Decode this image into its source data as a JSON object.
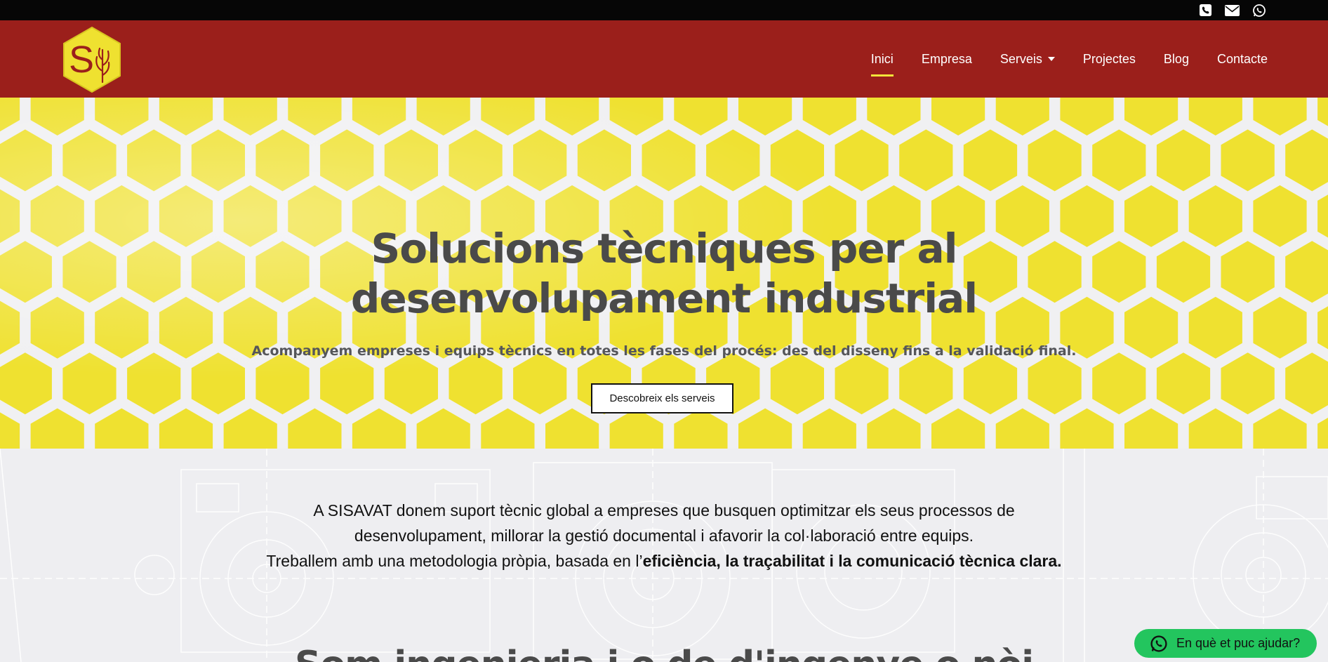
{
  "topbar": {
    "icons": [
      "phone-icon",
      "envelope-icon",
      "whatsapp-icon"
    ]
  },
  "header": {
    "logo": {
      "letter": "S",
      "icon": "wheat-icon"
    },
    "nav": [
      {
        "label": "Inici",
        "active": true
      },
      {
        "label": "Empresa",
        "active": false
      },
      {
        "label": "Serveis",
        "active": false,
        "dropdown": true
      },
      {
        "label": "Projectes",
        "active": false
      },
      {
        "label": "Blog",
        "active": false
      },
      {
        "label": "Contacte",
        "active": false
      }
    ]
  },
  "hero": {
    "title_line1": "Solucions tècniques per al",
    "title_line2": "desenvolupament industrial",
    "subtitle": "Acompanyem empreses i equips tècnics en totes les fases del procés: des del disseny fins a la validació final.",
    "button_label": "Descobreix els serveis"
  },
  "about": {
    "line1": "A SISAVAT donem suport tècnic global a empreses que busquen optimitzar els seus processos de",
    "line2": "desenvolupament, millorar la gestió documental i afavorir la col·laboració entre equips.",
    "line3_plain": "Treballem amb una metodologia pròpia, basada en l’",
    "line3_bold": "eficiència, la traçabilitat i la comunicació tècnica clara.",
    "next_heading": "Som ingenieria i o de d'ingenye o nòi"
  },
  "whatsapp": {
    "label": "En què et puc ajudar?"
  },
  "colors": {
    "topbar": "#060606",
    "header": "#9b1f1b",
    "accent_yellow": "#efe130",
    "hex_gap": "#f0f0f2",
    "whatsapp_green": "#23c55e"
  }
}
